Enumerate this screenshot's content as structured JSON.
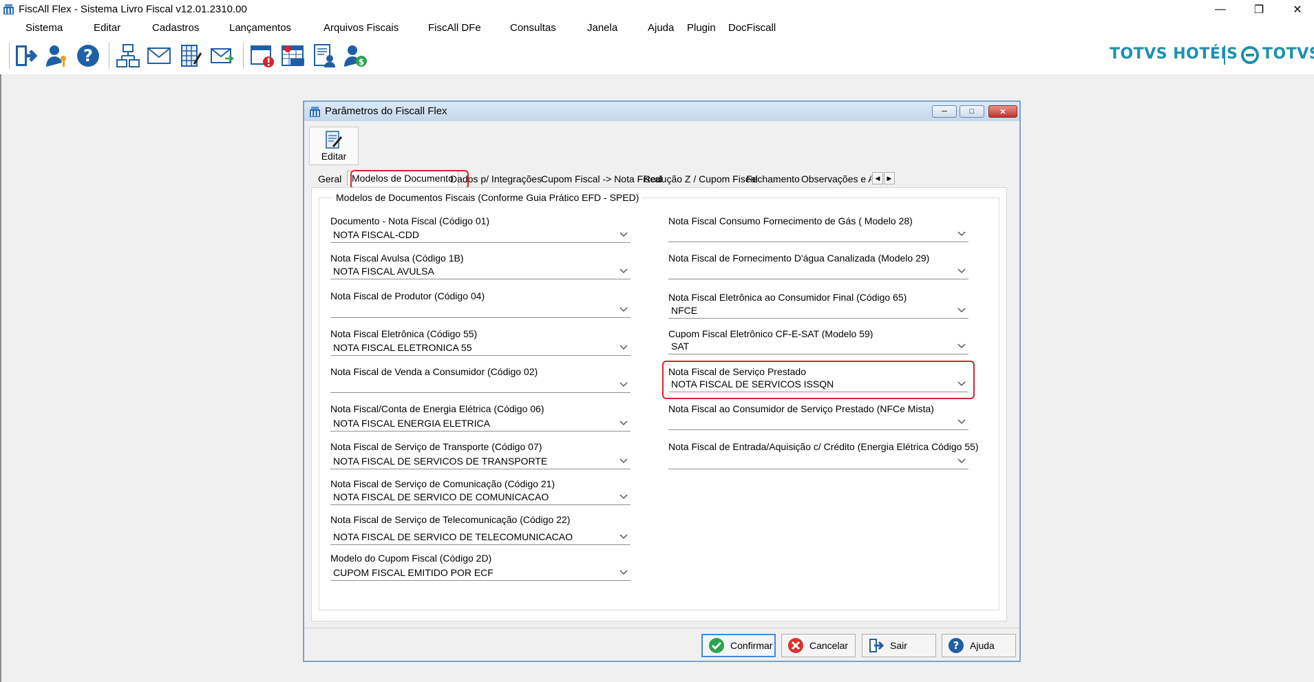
{
  "app": {
    "title": "FiscAll Flex - Sistema Livro Fiscal v12.01.2310.00"
  },
  "menu": [
    "Sistema",
    "Editar",
    "Cadastros",
    "Lançamentos",
    "Arquivos Fiscais",
    "FiscAll DFe",
    "Consultas",
    "Janela",
    "Ajuda",
    "Plugin",
    "DocFiscall"
  ],
  "brand": {
    "left": "TOTVS HOTÉIS",
    "right": "TOTVS",
    "color": "#1e8fb0"
  },
  "toolbar_icons": [
    "exit-icon",
    "user-key-icon",
    "help-icon",
    "network-icon",
    "mail-icon",
    "document-grid-icon",
    "send-mail-icon",
    "calendar-alert-icon",
    "calendar-icms-icon",
    "user-report-icon",
    "user-money-icon"
  ],
  "dialog": {
    "title": "Parâmetros do Fiscall Flex",
    "edit_label": "Editar",
    "tabs": [
      "Geral",
      "Modelos de Documento",
      "Dados p/ Integrações",
      "Cupom Fiscal -> Nota Fiscal",
      "Redução Z / Cupom Fiscal",
      "Fechamento",
      "Observações e Ajus"
    ],
    "active_tab": "Modelos de Documento",
    "group_title": "Modelos de Documentos Fiscais (Conforme Guia Prático EFD - SPED)",
    "left_fields": [
      {
        "label": "Documento - Nota Fiscal (Código 01)",
        "value": "NOTA FISCAL-CDD"
      },
      {
        "label": "Nota Fiscal Avulsa (Código 1B)",
        "value": "NOTA FISCAL AVULSA"
      },
      {
        "label": "Nota Fiscal de Produtor (Código 04)",
        "value": ""
      },
      {
        "label": "Nota Fiscal Eletrônica (Código 55)",
        "value": "NOTA FISCAL ELETRONICA 55"
      },
      {
        "label": "Nota Fiscal de Venda a Consumidor (Código 02)",
        "value": ""
      },
      {
        "label": "Nota Fiscal/Conta de Energia Elétrica (Código 06)",
        "value": "NOTA FISCAL ENERGIA ELETRICA"
      },
      {
        "label": "Nota Fiscal de Serviço de Transporte (Código 07)",
        "value": "NOTA FISCAL DE SERVICOS DE TRANSPORTE"
      },
      {
        "label": "Nota Fiscal de Serviço de Comunicação (Código 21)",
        "value": "NOTA FISCAL DE SERVICO DE COMUNICACAO"
      },
      {
        "label": "Nota Fiscal de Serviço de Telecomunicação (Código 22)",
        "value": "NOTA FISCAL DE SERVICO DE TELECOMUNICACAO"
      },
      {
        "label": "Modelo do Cupom Fiscal (Código 2D)",
        "value": "CUPOM FISCAL EMITIDO POR ECF"
      }
    ],
    "right_fields": [
      {
        "label": "Nota Fiscal Consumo Fornecimento de Gás ( Modelo 28)",
        "value": ""
      },
      {
        "label": "Nota Fiscal de Fornecimento D'água Canalizada (Modelo 29)",
        "value": ""
      },
      {
        "label": "Nota Fiscal Eletrônica ao Consumidor Final (Código 65)",
        "value": "NFCE"
      },
      {
        "label": "Cupom Fiscal Eletrônico CF-E-SAT (Modelo 59)",
        "value": "SAT"
      },
      {
        "label": "Nota Fiscal de Serviço Prestado",
        "value": "NOTA FISCAL DE SERVICOS ISSQN"
      },
      {
        "label": "Nota Fiscal ao Consumidor de Serviço Prestado (NFCe Mista)",
        "value": ""
      },
      {
        "label": "Nota Fiscal de Entrada/Aquisição c/ Crédito (Energia Elétrica Código 55)",
        "value": ""
      }
    ],
    "buttons": {
      "confirm": "Confirmar",
      "cancel": "Cancelar",
      "exit": "Sair",
      "help": "Ajuda"
    }
  },
  "colors": {
    "highlight": "#d9232e",
    "confirm_green": "#2ea44f",
    "cancel_red": "#d9342b",
    "icon_blue": "#1f5fa8"
  }
}
